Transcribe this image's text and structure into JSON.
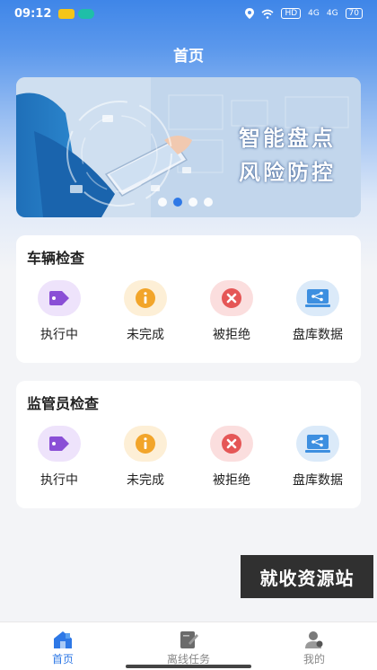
{
  "status_bar": {
    "time": "09:12",
    "right_text": "HD",
    "signal_text": "4G",
    "battery": "70"
  },
  "header": {
    "title": "首页"
  },
  "banner": {
    "line1": "智能盘点",
    "line2": "风险防控",
    "page_count": 4,
    "active_index": 1
  },
  "vehicle_section": {
    "title": "车辆检查",
    "items": [
      {
        "label": "执行中",
        "icon": "tag-icon"
      },
      {
        "label": "未完成",
        "icon": "info-icon"
      },
      {
        "label": "被拒绝",
        "icon": "close-icon"
      },
      {
        "label": "盘库数据",
        "icon": "monitor-share-icon"
      }
    ]
  },
  "supervisor_section": {
    "title": "监管员检查",
    "items": [
      {
        "label": "执行中",
        "icon": "tag-icon"
      },
      {
        "label": "未完成",
        "icon": "info-icon"
      },
      {
        "label": "被拒绝",
        "icon": "close-icon"
      },
      {
        "label": "盘库数据",
        "icon": "monitor-share-icon"
      }
    ]
  },
  "watermark": "就收资源站",
  "tabbar": {
    "items": [
      {
        "label": "首页",
        "icon": "home-icon",
        "active": true
      },
      {
        "label": "离线任务",
        "icon": "notebook-icon",
        "active": false
      },
      {
        "label": "我的",
        "icon": "user-icon",
        "active": false
      }
    ]
  },
  "colors": {
    "accent": "#2e78e6",
    "purple": "#8a4fd6",
    "orange": "#f2a52a",
    "red": "#e55656",
    "blue": "#3d8fe0"
  }
}
